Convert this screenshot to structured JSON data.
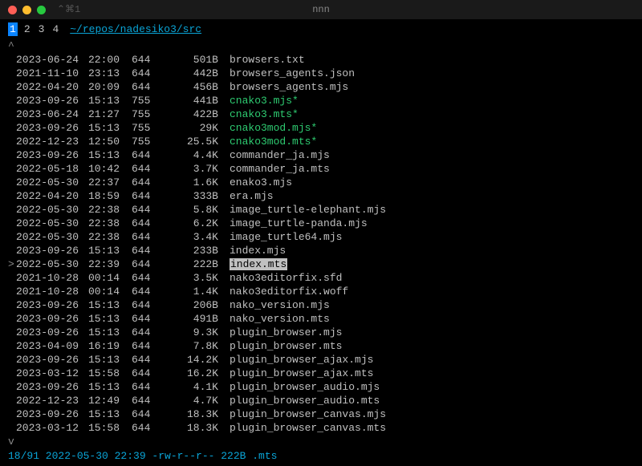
{
  "window": {
    "shortcut": "⌃⌘1",
    "title": "nnn"
  },
  "tabs": [
    "1",
    "2",
    "3",
    "4"
  ],
  "active_tab": 0,
  "path": "~/repos/nadesiko3/src",
  "scroll_up_marker": "^",
  "scroll_down_marker": "v",
  "selected_index": 13,
  "files": [
    {
      "date": "2023-06-24",
      "time": "22:00",
      "perm": "644",
      "size": "501B",
      "name": "browsers.txt",
      "exec": false
    },
    {
      "date": "2021-11-10",
      "time": "23:13",
      "perm": "644",
      "size": "442B",
      "name": "browsers_agents.json",
      "exec": false
    },
    {
      "date": "2022-04-20",
      "time": "20:09",
      "perm": "644",
      "size": "456B",
      "name": "browsers_agents.mjs",
      "exec": false
    },
    {
      "date": "2023-09-26",
      "time": "15:13",
      "perm": "755",
      "size": "441B",
      "name": "cnako3.mjs*",
      "exec": true
    },
    {
      "date": "2023-06-24",
      "time": "21:27",
      "perm": "755",
      "size": "422B",
      "name": "cnako3.mts*",
      "exec": true
    },
    {
      "date": "2023-09-26",
      "time": "15:13",
      "perm": "755",
      "size": "29K",
      "name": "cnako3mod.mjs*",
      "exec": true
    },
    {
      "date": "2022-12-23",
      "time": "12:50",
      "perm": "755",
      "size": "25.5K",
      "name": "cnako3mod.mts*",
      "exec": true
    },
    {
      "date": "2023-09-26",
      "time": "15:13",
      "perm": "644",
      "size": "4.4K",
      "name": "commander_ja.mjs",
      "exec": false
    },
    {
      "date": "2022-05-18",
      "time": "10:42",
      "perm": "644",
      "size": "3.7K",
      "name": "commander_ja.mts",
      "exec": false
    },
    {
      "date": "2022-05-30",
      "time": "22:37",
      "perm": "644",
      "size": "1.6K",
      "name": "enako3.mjs",
      "exec": false
    },
    {
      "date": "2022-04-20",
      "time": "18:59",
      "perm": "644",
      "size": "333B",
      "name": "era.mjs",
      "exec": false
    },
    {
      "date": "2022-05-30",
      "time": "22:38",
      "perm": "644",
      "size": "5.8K",
      "name": "image_turtle-elephant.mjs",
      "exec": false
    },
    {
      "date": "2022-05-30",
      "time": "22:38",
      "perm": "644",
      "size": "6.2K",
      "name": "image_turtle-panda.mjs",
      "exec": false
    },
    {
      "date": "2022-05-30",
      "time": "22:38",
      "perm": "644",
      "size": "3.4K",
      "name": "image_turtle64.mjs",
      "exec": false
    },
    {
      "date": "2023-09-26",
      "time": "15:13",
      "perm": "644",
      "size": "233B",
      "name": "index.mjs",
      "exec": false
    },
    {
      "date": "2022-05-30",
      "time": "22:39",
      "perm": "644",
      "size": "222B",
      "name": "index.mts",
      "exec": false
    },
    {
      "date": "2021-10-28",
      "time": "00:14",
      "perm": "644",
      "size": "3.5K",
      "name": "nako3editorfix.sfd",
      "exec": false
    },
    {
      "date": "2021-10-28",
      "time": "00:14",
      "perm": "644",
      "size": "1.4K",
      "name": "nako3editorfix.woff",
      "exec": false
    },
    {
      "date": "2023-09-26",
      "time": "15:13",
      "perm": "644",
      "size": "206B",
      "name": "nako_version.mjs",
      "exec": false
    },
    {
      "date": "2023-09-26",
      "time": "15:13",
      "perm": "644",
      "size": "491B",
      "name": "nako_version.mts",
      "exec": false
    },
    {
      "date": "2023-09-26",
      "time": "15:13",
      "perm": "644",
      "size": "9.3K",
      "name": "plugin_browser.mjs",
      "exec": false
    },
    {
      "date": "2023-04-09",
      "time": "16:19",
      "perm": "644",
      "size": "7.8K",
      "name": "plugin_browser.mts",
      "exec": false
    },
    {
      "date": "2023-09-26",
      "time": "15:13",
      "perm": "644",
      "size": "14.2K",
      "name": "plugin_browser_ajax.mjs",
      "exec": false
    },
    {
      "date": "2023-03-12",
      "time": "15:58",
      "perm": "644",
      "size": "16.2K",
      "name": "plugin_browser_ajax.mts",
      "exec": false
    },
    {
      "date": "2023-09-26",
      "time": "15:13",
      "perm": "644",
      "size": "4.1K",
      "name": "plugin_browser_audio.mjs",
      "exec": false
    },
    {
      "date": "2022-12-23",
      "time": "12:49",
      "perm": "644",
      "size": "4.7K",
      "name": "plugin_browser_audio.mts",
      "exec": false
    },
    {
      "date": "2023-09-26",
      "time": "15:13",
      "perm": "644",
      "size": "18.3K",
      "name": "plugin_browser_canvas.mjs",
      "exec": false
    },
    {
      "date": "2023-03-12",
      "time": "15:58",
      "perm": "644",
      "size": "18.3K",
      "name": "plugin_browser_canvas.mts",
      "exec": false
    }
  ],
  "status": "18/91 2022-05-30 22:39 -rw-r--r-- 222B .mts"
}
